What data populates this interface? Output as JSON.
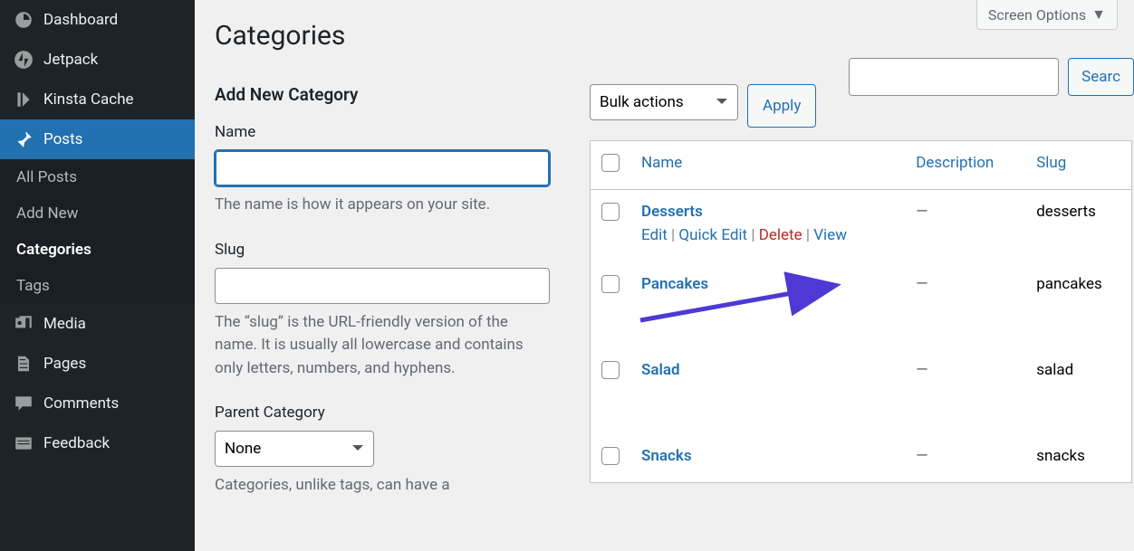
{
  "screen_options_label": "Screen Options",
  "page_title": "Categories",
  "sidebar": {
    "items": [
      {
        "label": "Dashboard",
        "icon": "dashboard"
      },
      {
        "label": "Jetpack",
        "icon": "jetpack"
      },
      {
        "label": "Kinsta Cache",
        "icon": "kinsta"
      },
      {
        "label": "Posts",
        "icon": "pin"
      },
      {
        "label": "Media",
        "icon": "media"
      },
      {
        "label": "Pages",
        "icon": "pages"
      },
      {
        "label": "Comments",
        "icon": "comment"
      },
      {
        "label": "Feedback",
        "icon": "feedback"
      }
    ],
    "posts_submenu": [
      {
        "label": "All Posts"
      },
      {
        "label": "Add New"
      },
      {
        "label": "Categories"
      },
      {
        "label": "Tags"
      }
    ]
  },
  "form": {
    "heading": "Add New Category",
    "name_label": "Name",
    "name_value": "",
    "name_desc": "The name is how it appears on your site.",
    "slug_label": "Slug",
    "slug_value": "",
    "slug_desc": "The “slug” is the URL-friendly version of the name. It is usually all lowercase and contains only letters, numbers, and hyphens.",
    "parent_label": "Parent Category",
    "parent_selected": "None",
    "parent_desc": "Categories, unlike tags, can have a"
  },
  "search_button": "Searc",
  "bulk": {
    "selected": "Bulk actions",
    "apply": "Apply"
  },
  "table": {
    "headers": {
      "name": "Name",
      "description": "Description",
      "slug": "Slug"
    },
    "row_actions": {
      "edit": "Edit",
      "quick_edit": "Quick Edit",
      "delete": "Delete",
      "view": "View"
    },
    "rows": [
      {
        "name": "Desserts",
        "description": "—",
        "slug": "desserts"
      },
      {
        "name": "Pancakes",
        "description": "—",
        "slug": "pancakes"
      },
      {
        "name": "Salad",
        "description": "—",
        "slug": "salad"
      },
      {
        "name": "Snacks",
        "description": "—",
        "slug": "snacks"
      }
    ]
  }
}
